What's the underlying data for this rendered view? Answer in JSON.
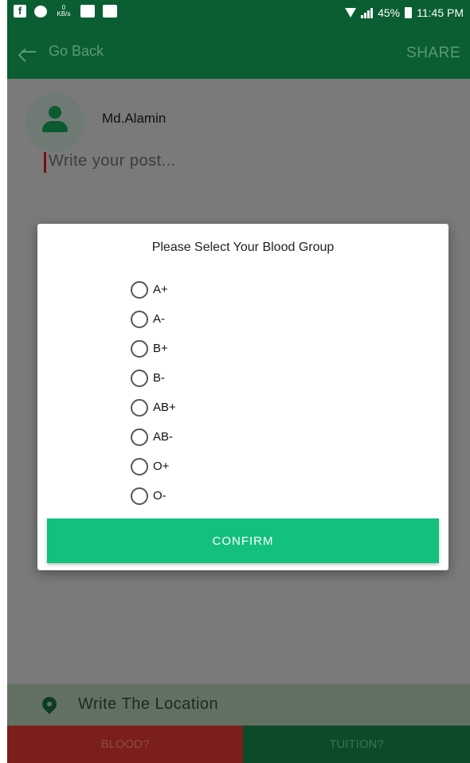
{
  "status_bar": {
    "net_speed_value": "0",
    "net_speed_unit": "KB/s",
    "battery": "45%",
    "time": "11:45 PM",
    "icons": [
      "facebook-icon",
      "messenger-icon",
      "image-icon",
      "activity-icon",
      "wifi-icon",
      "signal-icon",
      "battery-icon"
    ]
  },
  "app_bar": {
    "back_label": "Go Back",
    "share_label": "SHARE"
  },
  "post": {
    "username": "Md.Alamin",
    "placeholder": "Write your post..."
  },
  "dialog": {
    "title": "Please Select Your Blood Group",
    "options": [
      "A+",
      "A-",
      "B+",
      "B-",
      "AB+",
      "AB-",
      "O+",
      "O-"
    ],
    "confirm_label": "CONFIRM"
  },
  "location": {
    "placeholder": "Write The Location"
  },
  "bottom_tabs": {
    "blood_label": "BLOOD?",
    "tuition_label": "TUITION?"
  },
  "colors": {
    "primary_dark": "#0a5e32",
    "accent": "#13c07e",
    "blood_red": "#7a1f1a",
    "scrim": "#7a7a7a"
  }
}
